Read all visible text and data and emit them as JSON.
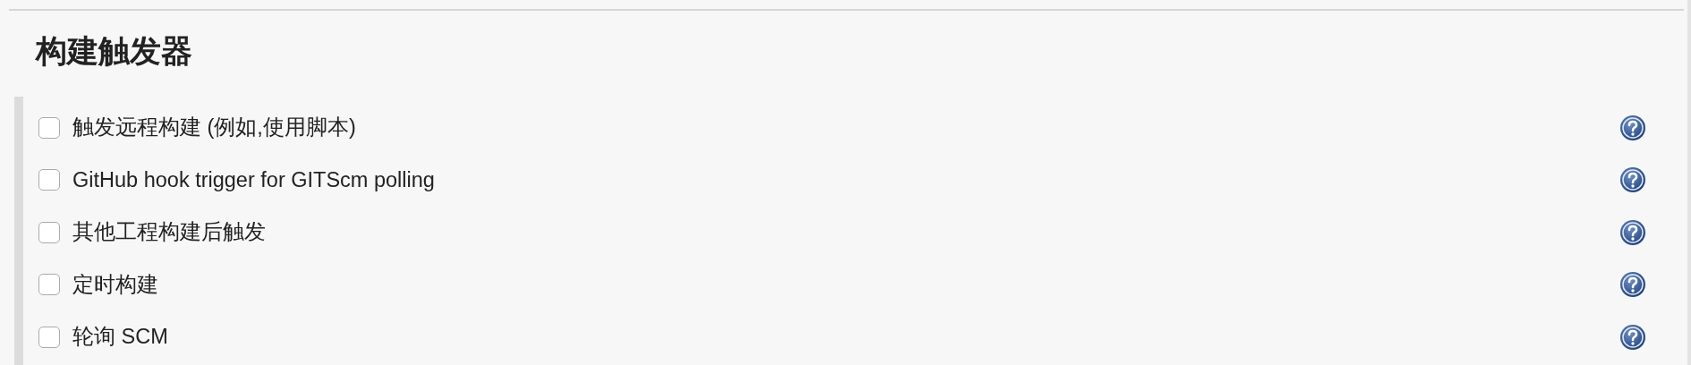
{
  "section": {
    "title": "构建触发器"
  },
  "options": [
    {
      "label": "触发远程构建 (例如,使用脚本)",
      "checked": false
    },
    {
      "label": "GitHub hook trigger for GITScm polling",
      "checked": false
    },
    {
      "label": "其他工程构建后触发",
      "checked": false
    },
    {
      "label": "定时构建",
      "checked": false
    },
    {
      "label": "轮询 SCM",
      "checked": false
    }
  ]
}
